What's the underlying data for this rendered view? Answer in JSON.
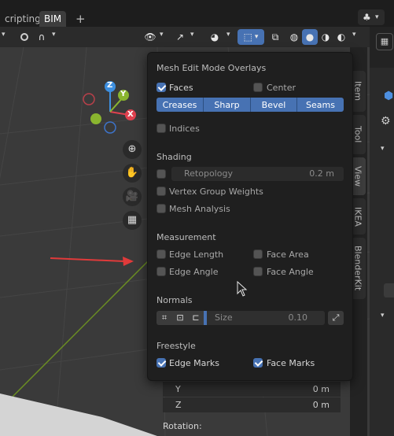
{
  "topbar": {
    "tabs": [
      {
        "label": "cripting",
        "active": false
      },
      {
        "label": "BIM",
        "active": true
      }
    ],
    "add_tab": "+"
  },
  "sidebar_tabs": [
    "Item",
    "Tool",
    "View",
    "IKEA",
    "BlenderKit"
  ],
  "overlay": {
    "title": "Mesh Edit Mode Overlays",
    "faces": {
      "label": "Faces",
      "checked": true
    },
    "center": {
      "label": "Center",
      "checked": false
    },
    "edge_buttons": [
      "Creases",
      "Sharp",
      "Bevel",
      "Seams"
    ],
    "indices": {
      "label": "Indices",
      "checked": false
    },
    "shading": {
      "title": "Shading",
      "retopology": {
        "label": "Retopology",
        "value": "0.2 m",
        "checked": false
      },
      "vertex_group_weights": {
        "label": "Vertex Group Weights",
        "checked": false
      },
      "mesh_analysis": {
        "label": "Mesh Analysis",
        "checked": false
      }
    },
    "measurement": {
      "title": "Measurement",
      "edge_length": "Edge Length",
      "face_area": "Face Area",
      "edge_angle": "Edge Angle",
      "face_angle": "Face Angle"
    },
    "normals": {
      "title": "Normals",
      "size_label": "Size",
      "size_value": "0.10"
    },
    "freestyle": {
      "title": "Freestyle",
      "edge_marks": {
        "label": "Edge Marks",
        "checked": true
      },
      "face_marks": {
        "label": "Face Marks",
        "checked": true
      }
    }
  },
  "transform": {
    "y_label": "Y",
    "y_value": "0 m",
    "z_label": "Z",
    "z_value": "0 m",
    "rotation_label": "Rotation:"
  },
  "gizmo": {
    "x": "X",
    "y": "Y",
    "z": "Z"
  },
  "colors": {
    "accent": "#4772b3",
    "x_axis": "#e0414f",
    "y_axis": "#8ab52f",
    "z_axis": "#3d8fe0"
  }
}
